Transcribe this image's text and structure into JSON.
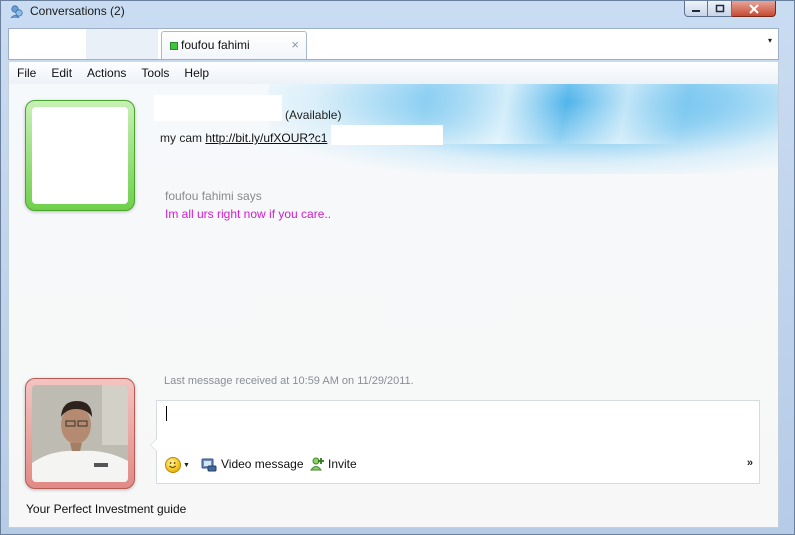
{
  "window": {
    "title": "Conversations (2)"
  },
  "tabs": {
    "active_label": "foufou fahimi",
    "close_glyph": "×",
    "overflow_glyph": "▾"
  },
  "menu": {
    "items": [
      "File",
      "Edit",
      "Actions",
      "Tools",
      "Help"
    ]
  },
  "contact": {
    "status": "(Available)",
    "psm_prefix": "my cam ",
    "psm_link": "http://bit.ly/ufXOUR?c1",
    "presence_color": "#5cc93a"
  },
  "conversation": {
    "sender_line": "foufou fahimi says",
    "message": "Im all urs right now if you care..",
    "message_color": "#d21bd2"
  },
  "status_line": "Last message received at 10:59 AM on 11/29/2011.",
  "compose": {
    "video_message_label": "Video message",
    "invite_label": "Invite",
    "more_glyph": "»",
    "emoticon_icon": "emoticon-icon",
    "video_icon": "video-message-icon",
    "invite_icon": "invite-icon"
  },
  "user": {
    "presence_color": "#e18a86"
  },
  "footer_text": "Your Perfect Investment  guide"
}
